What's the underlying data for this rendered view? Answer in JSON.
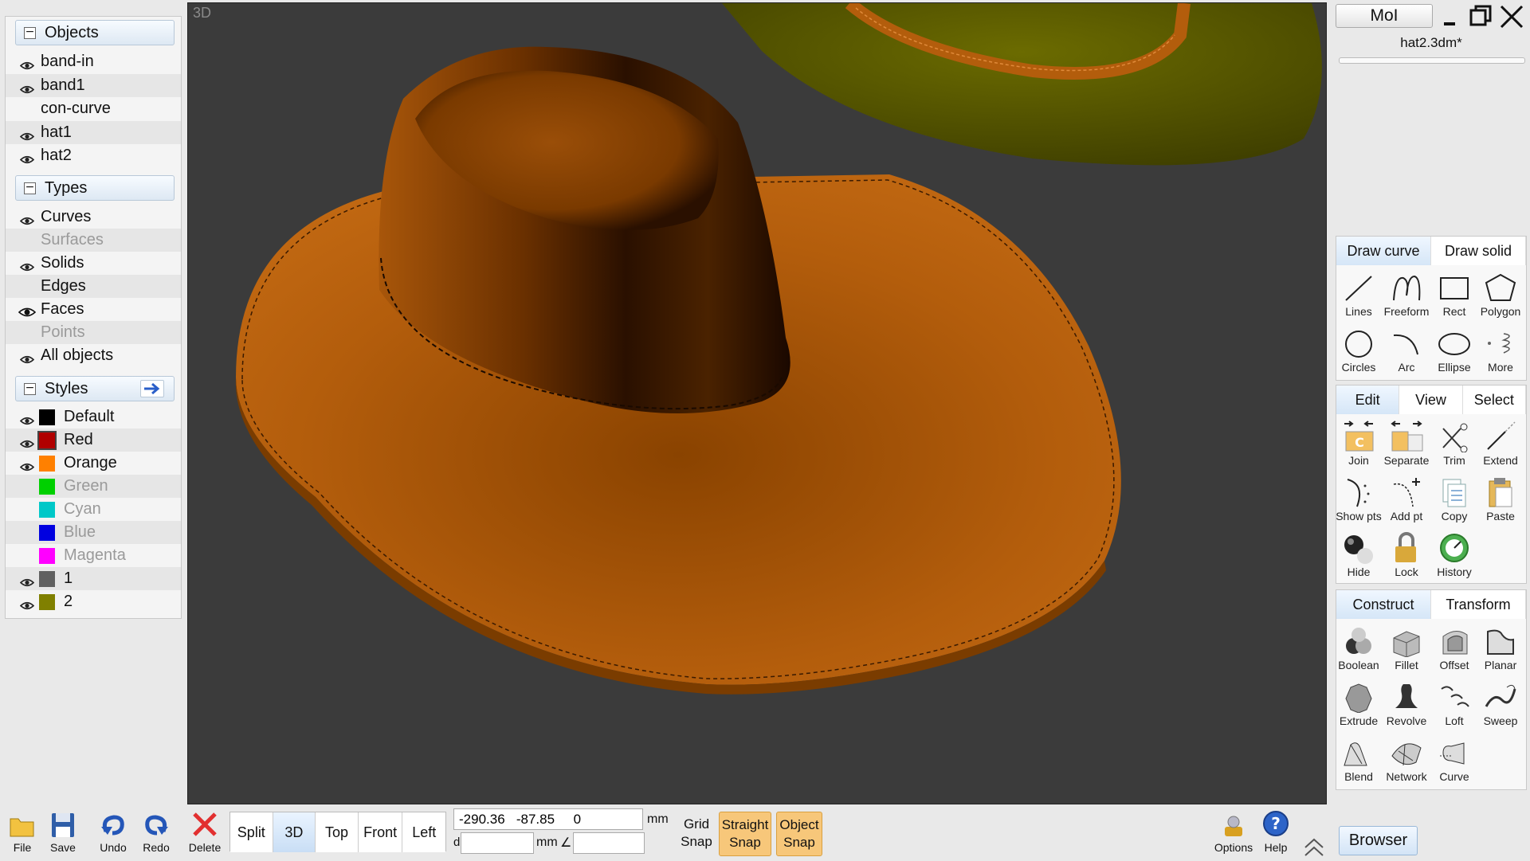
{
  "objects": {
    "header": "Objects",
    "toggle": "−",
    "items": [
      "band-in",
      "band1",
      "con-curve",
      "hat1",
      "hat2"
    ],
    "visible": [
      true,
      true,
      false,
      true,
      true
    ]
  },
  "types": {
    "header": "Types",
    "toggle": "−",
    "items": [
      "Curves",
      "Surfaces",
      "Solids",
      "Edges",
      "Faces",
      "Points",
      "All objects"
    ],
    "dim": [
      false,
      true,
      false,
      false,
      false,
      true,
      false
    ],
    "eye": [
      true,
      false,
      true,
      false,
      "open",
      false,
      true
    ]
  },
  "styles": {
    "header": "Styles",
    "toggle": "−",
    "items": [
      {
        "name": "Default",
        "color": "#000000",
        "dim": false,
        "eye": true
      },
      {
        "name": "Red",
        "color": "#b00000",
        "dim": false,
        "eye": true
      },
      {
        "name": "Orange",
        "color": "#ff8000",
        "dim": false,
        "eye": true
      },
      {
        "name": "Green",
        "color": "#00d000",
        "dim": true,
        "eye": false
      },
      {
        "name": "Cyan",
        "color": "#00c8c8",
        "dim": true,
        "eye": false
      },
      {
        "name": "Blue",
        "color": "#0000e0",
        "dim": true,
        "eye": false
      },
      {
        "name": "Magenta",
        "color": "#ff00ff",
        "dim": true,
        "eye": false
      },
      {
        "name": "1",
        "color": "#606060",
        "dim": false,
        "eye": true
      },
      {
        "name": "2",
        "color": "#808000",
        "dim": false,
        "eye": true
      }
    ]
  },
  "viewport": {
    "label": "3D"
  },
  "app": {
    "name": "MoI",
    "filename": "hat2.3dm*"
  },
  "draw": {
    "tabs": [
      "Draw curve",
      "Draw solid"
    ],
    "tools": [
      "Lines",
      "Freeform",
      "Rect",
      "Polygon",
      "Circles",
      "Arc",
      "Ellipse",
      "More"
    ]
  },
  "edit": {
    "tabs": [
      "Edit",
      "View",
      "Select"
    ],
    "tools": [
      "Join",
      "Separate",
      "Trim",
      "Extend",
      "Show pts",
      "Add pt",
      "Copy",
      "Paste",
      "Hide",
      "Lock",
      "History"
    ]
  },
  "construct": {
    "tabs": [
      "Construct",
      "Transform"
    ],
    "tools": [
      "Boolean",
      "Fillet",
      "Offset",
      "Planar",
      "Extrude",
      "Revolve",
      "Loft",
      "Sweep",
      "Blend",
      "Network",
      "Curve"
    ]
  },
  "bottom": {
    "file": "File",
    "save": "Save",
    "undo": "Undo",
    "redo": "Redo",
    "delete": "Delete",
    "views": [
      "Split",
      "3D",
      "Top",
      "Front",
      "Left"
    ],
    "coord": "-290.36   -87.85     0",
    "unit": "mm",
    "d_label": "d",
    "unit2": "mm",
    "angle": "∠",
    "grid_snap": [
      "Grid",
      "Snap"
    ],
    "straight_snap": [
      "Straight",
      "Snap"
    ],
    "object_snap": [
      "Object",
      "Snap"
    ],
    "options": "Options",
    "help": "Help",
    "browser": "Browser"
  },
  "colors": {
    "accent_tab": "#d5e6f7",
    "snap_on": "#f7c77a",
    "hat_orange": "#b35d0c",
    "hat_olive": "#5e5e00"
  }
}
